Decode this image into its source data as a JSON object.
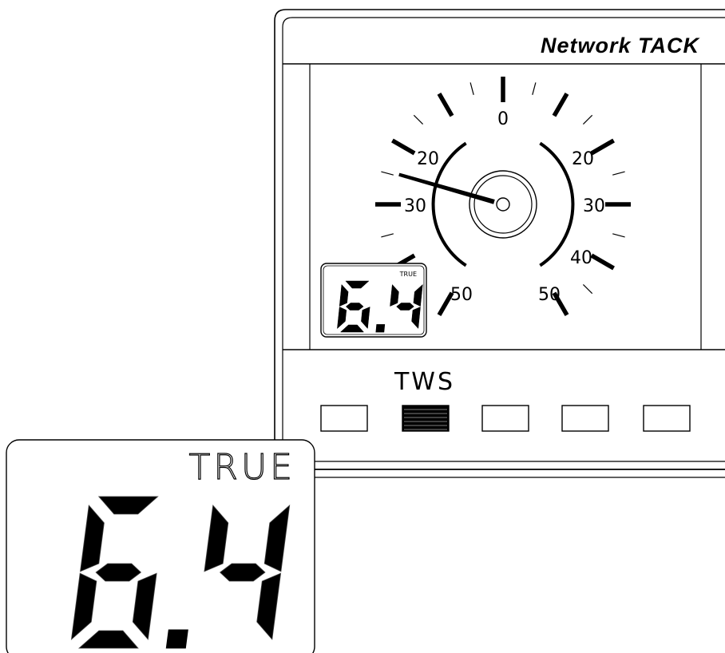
{
  "instrument": {
    "brand": "Network TACK",
    "mode_label": "TWS",
    "soft_keys": [
      "key-1",
      "key-2",
      "key-3",
      "key-4",
      "key-5"
    ],
    "active_key_index": 1
  },
  "dial": {
    "labels_left": [
      "0",
      "20",
      "30",
      "50"
    ],
    "labels_right": [
      "20",
      "30",
      "40",
      "50"
    ],
    "needle_angle_deg": -74
  },
  "small_display": {
    "caption": "TRUE",
    "value": "6.4"
  },
  "zoom_display": {
    "caption": "TRUE",
    "value": "6.4"
  },
  "colors": {
    "ink": "#000000",
    "paper": "#ffffff"
  }
}
